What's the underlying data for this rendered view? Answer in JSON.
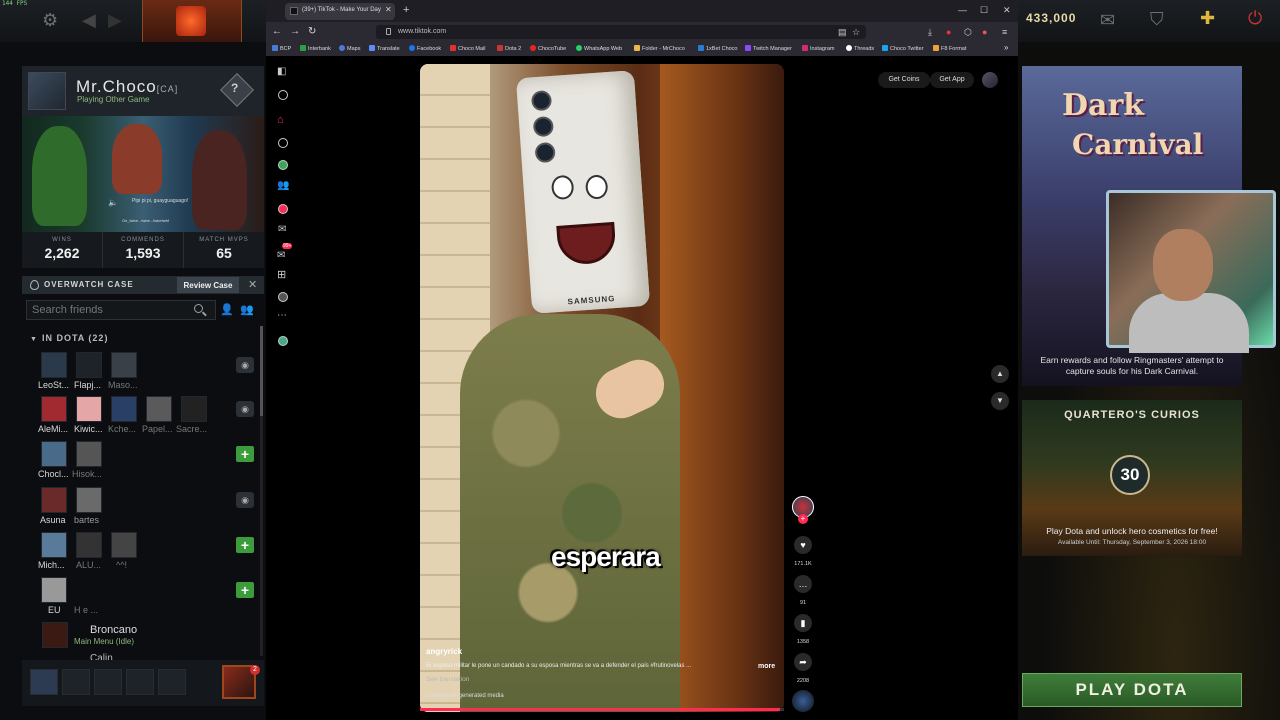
{
  "hud": {
    "fps": "144 FPS",
    "gold": "433,000"
  },
  "profile": {
    "name": "Mr.Choco",
    "tag": "[CA]",
    "status": "Playing Other Game",
    "rank_symbol": "?",
    "music_line1": "Pipi pi pi, guayguaguago!",
    "music_line2": "Oe_fwbe...fwbe...fwbefwbf",
    "stats": [
      {
        "label": "WINS",
        "value": "2,262"
      },
      {
        "label": "COMMENDS",
        "value": "1,593"
      },
      {
        "label": "MATCH MVPS",
        "value": "65"
      }
    ]
  },
  "overwatch": {
    "label": "OVERWATCH CASE",
    "button": "Review Case",
    "close": "✕"
  },
  "friends": {
    "search_placeholder": "Search friends",
    "section": "IN DOTA (22)",
    "rows": [
      {
        "names": [
          "LeoSt...",
          "Flapj...",
          "Maso..."
        ]
      },
      {
        "names": [
          "AleMi...",
          "Kiwic...",
          "Kche...",
          "Papel...",
          "Sacre..."
        ]
      },
      {
        "names": [
          "Chocl...",
          "Hisok..."
        ]
      },
      {
        "names": [
          "Asuna",
          "bartes"
        ]
      },
      {
        "names": [
          "Mich...",
          "ALU...",
          "^^!"
        ]
      },
      {
        "names": [
          "EU",
          "H e ..."
        ]
      }
    ],
    "broncano": {
      "name": "Broncano",
      "status": "Main Menu (Idle)"
    },
    "next": "Calin",
    "chat_badge": "2"
  },
  "browser": {
    "tab_title": "(39+) TikTok - Make Your Day",
    "url": "www.tiktok.com",
    "bookmarks": [
      "BCP",
      "Interbank",
      "Maps",
      "Translate",
      "Facebook",
      "Choco Mail",
      "Dota 2",
      "ChocoTube",
      "WhatsApp Web",
      "Folder - MrChoco",
      "1xBet Choco",
      "Twitch Manager",
      "Instagram",
      "Threads",
      "Choco Twitter",
      "F8 Format"
    ],
    "bookmark_colors": [
      "#4a7bd6",
      "#2aa04a",
      "#4a7bd6",
      "#5a8ef2",
      "#1877f2",
      "#d33",
      "#c33",
      "#e22",
      "#25d366",
      "#e8b84a",
      "#2a7ad6",
      "#9146ff",
      "#d6297a",
      "#fff",
      "#1da1f2",
      "#f2a03a"
    ]
  },
  "tiktok": {
    "get_coins": "Get Coins",
    "get_app": "Get App",
    "caption": "esperara",
    "author": "angryrick",
    "description": "El esposo militar le pone un candado a su esposa mientras se va a defender el país #frutinovelas ...",
    "more": "more",
    "see_translation": "See translation",
    "ai_label": "Contains AI-generated media",
    "likes": "171.1K",
    "comments": "91",
    "saves": "1358",
    "shares": "2208",
    "sidebar_badge": "99+",
    "samsung_text": "SAMSUNG",
    "progress": 0.99
  },
  "right_panel": {
    "carnival_title_1": "Dark",
    "carnival_title_2": "Carnival",
    "carnival_desc": "Earn rewards and follow Ringmasters' attempt to capture souls for his Dark Carnival.",
    "curios_title": "QUARTERO'S CURIOS",
    "curios_number": "30",
    "curios_desc": "Play Dota and unlock hero cosmetics for free!",
    "curios_avail": "Available Until:  Thursday, September 3, 2026 18:00",
    "play_button": "PLAY DOTA"
  }
}
